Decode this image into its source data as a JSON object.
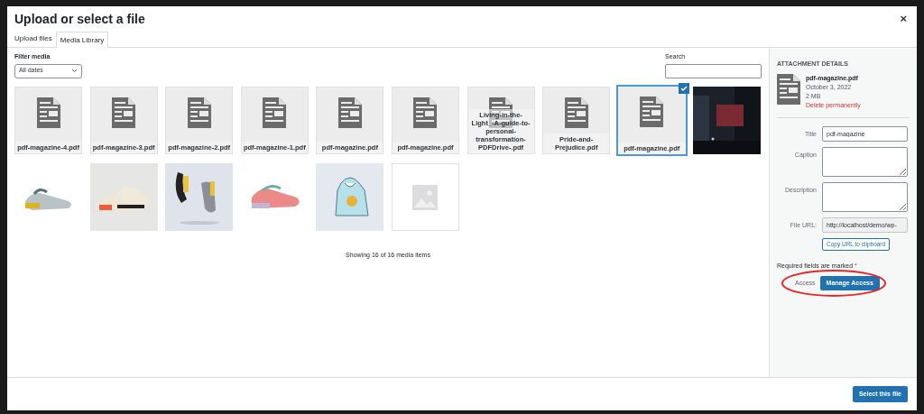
{
  "window": {
    "title": "Upload or select a file",
    "close": "×"
  },
  "tabs": [
    {
      "label": "Upload files",
      "selected": false
    },
    {
      "label": "Media Library",
      "selected": true
    }
  ],
  "filter": {
    "label": "Filter media",
    "value": "All dates"
  },
  "search": {
    "label": "Search"
  },
  "media": [
    {
      "kind": "document",
      "filename": "pdf-magazine-4.pdf",
      "selected": false
    },
    {
      "kind": "document",
      "filename": "pdf-magazine-3.pdf",
      "selected": false
    },
    {
      "kind": "document",
      "filename": "pdf-magazine-2.pdf",
      "selected": false
    },
    {
      "kind": "document",
      "filename": "pdf-magazine-1.pdf",
      "selected": false
    },
    {
      "kind": "document",
      "filename": "pdf-magazine.pdf",
      "selected": false
    },
    {
      "kind": "document",
      "filename": "pdf-magazine.pdf",
      "selected": false
    },
    {
      "kind": "document",
      "filename": "Living-in-the-Light_-A-guide-to-personal-transformation-PDFDrive-.pdf",
      "selected": false
    },
    {
      "kind": "document",
      "filename": "Pride-and-Prejudice.pdf",
      "selected": false
    },
    {
      "kind": "document",
      "filename": "pdf-magazine.pdf",
      "selected": true
    },
    {
      "kind": "picture",
      "selected": false
    },
    {
      "kind": "picture",
      "selected": false
    },
    {
      "kind": "picture",
      "selected": false
    },
    {
      "kind": "picture",
      "selected": false
    },
    {
      "kind": "picture",
      "selected": false
    },
    {
      "kind": "picture",
      "selected": false
    },
    {
      "kind": "placeholder",
      "selected": false
    }
  ],
  "count": "Showing 16 of 16 media items",
  "details": {
    "heading": "ATTACHMENT DETAILS",
    "filename": "pdf-magazine.pdf",
    "date": "October 3, 2022",
    "size": "2 MB",
    "delete": "Delete permanently",
    "fields": [
      {
        "kind": "input",
        "label": "Title",
        "value": "pdf-magazine"
      },
      {
        "kind": "textarea",
        "label": "Caption"
      },
      {
        "kind": "textarea",
        "label": "Description"
      },
      {
        "kind": "url",
        "label": "File URL:",
        "value": "http://localhost/demo/wp-"
      }
    ],
    "copy": "Copy URL to clipboard",
    "required": "Required fields are marked",
    "required_mark": "*",
    "access_label": "Access",
    "access_button": "Manage Access"
  },
  "footer": {
    "button": "Select this file"
  }
}
